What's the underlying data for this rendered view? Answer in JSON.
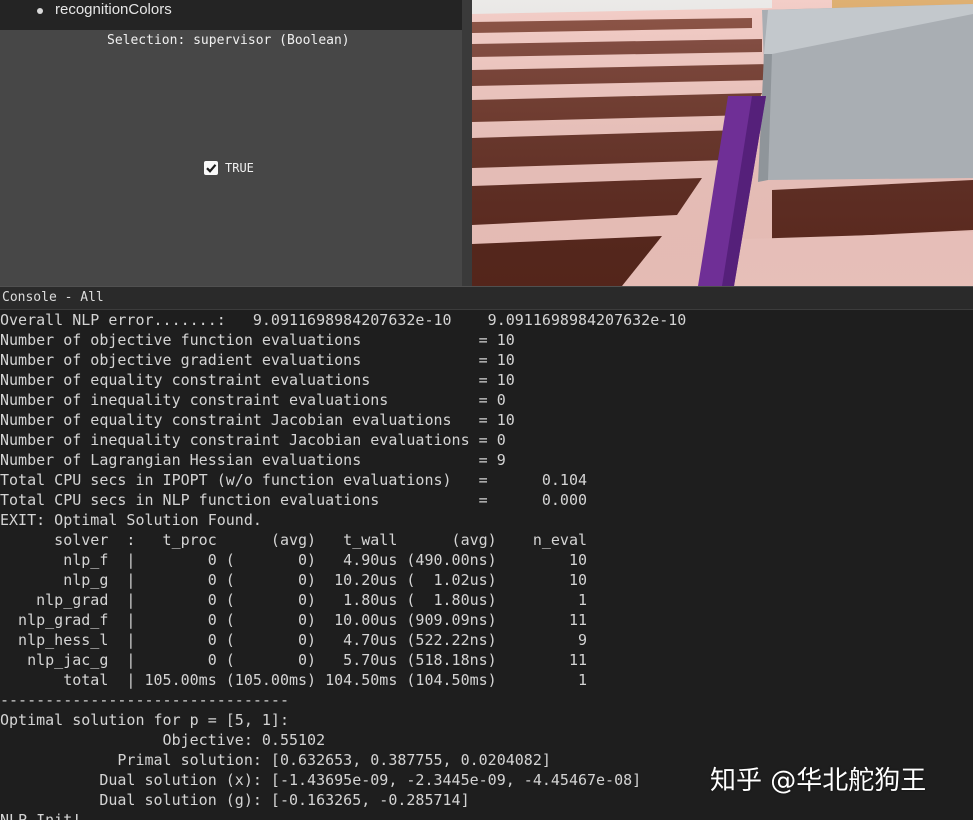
{
  "properties": {
    "tree_item_label": "recognitionColors",
    "selection_label": "Selection: supervisor (Boolean)",
    "checkbox_checked": true,
    "checkbox_label": "TRUE"
  },
  "console": {
    "title": "Console - All",
    "lines": [
      "Overall NLP error.......:   9.0911698984207632e-10    9.0911698984207632e-10",
      "Number of objective function evaluations             = 10",
      "Number of objective gradient evaluations             = 10",
      "Number of equality constraint evaluations            = 10",
      "Number of inequality constraint evaluations          = 0",
      "Number of equality constraint Jacobian evaluations   = 10",
      "Number of inequality constraint Jacobian evaluations = 0",
      "Number of Lagrangian Hessian evaluations             = 9",
      "Total CPU secs in IPOPT (w/o function evaluations)   =      0.104",
      "Total CPU secs in NLP function evaluations           =      0.000",
      "EXIT: Optimal Solution Found.",
      "      solver  :   t_proc      (avg)   t_wall      (avg)    n_eval",
      "       nlp_f  |        0 (       0)   4.90us (490.00ns)        10",
      "       nlp_g  |        0 (       0)  10.20us (  1.02us)        10",
      "    nlp_grad  |        0 (       0)   1.80us (  1.80us)         1",
      "  nlp_grad_f  |        0 (       0)  10.00us (909.09ns)        11",
      "  nlp_hess_l  |        0 (       0)   4.70us (522.22ns)         9",
      "   nlp_jac_g  |        0 (       0)   5.70us (518.18ns)        11",
      "       total  | 105.00ms (105.00ms) 104.50ms (104.50ms)         1",
      "--------------------------------",
      "Optimal solution for p = [5, 1]:",
      "                  Objective: 0.55102",
      "             Primal solution: [0.632653, 0.387755, 0.0204082]",
      "           Dual solution (x): [-1.43695e-09, -2.3445e-09, -4.45467e-08]",
      "           Dual solution (g): [-0.163265, -0.285714]",
      "NLP Init!"
    ]
  },
  "watermark": "知乎 @华北舵狗王",
  "colors": {
    "console_bg": "#1e1e1e",
    "panel_bg": "#474747",
    "floor_light": "#f1c5be",
    "floor_dark": "#7a3a2a",
    "box": "#a7adb3",
    "board": "#6f2f96"
  }
}
